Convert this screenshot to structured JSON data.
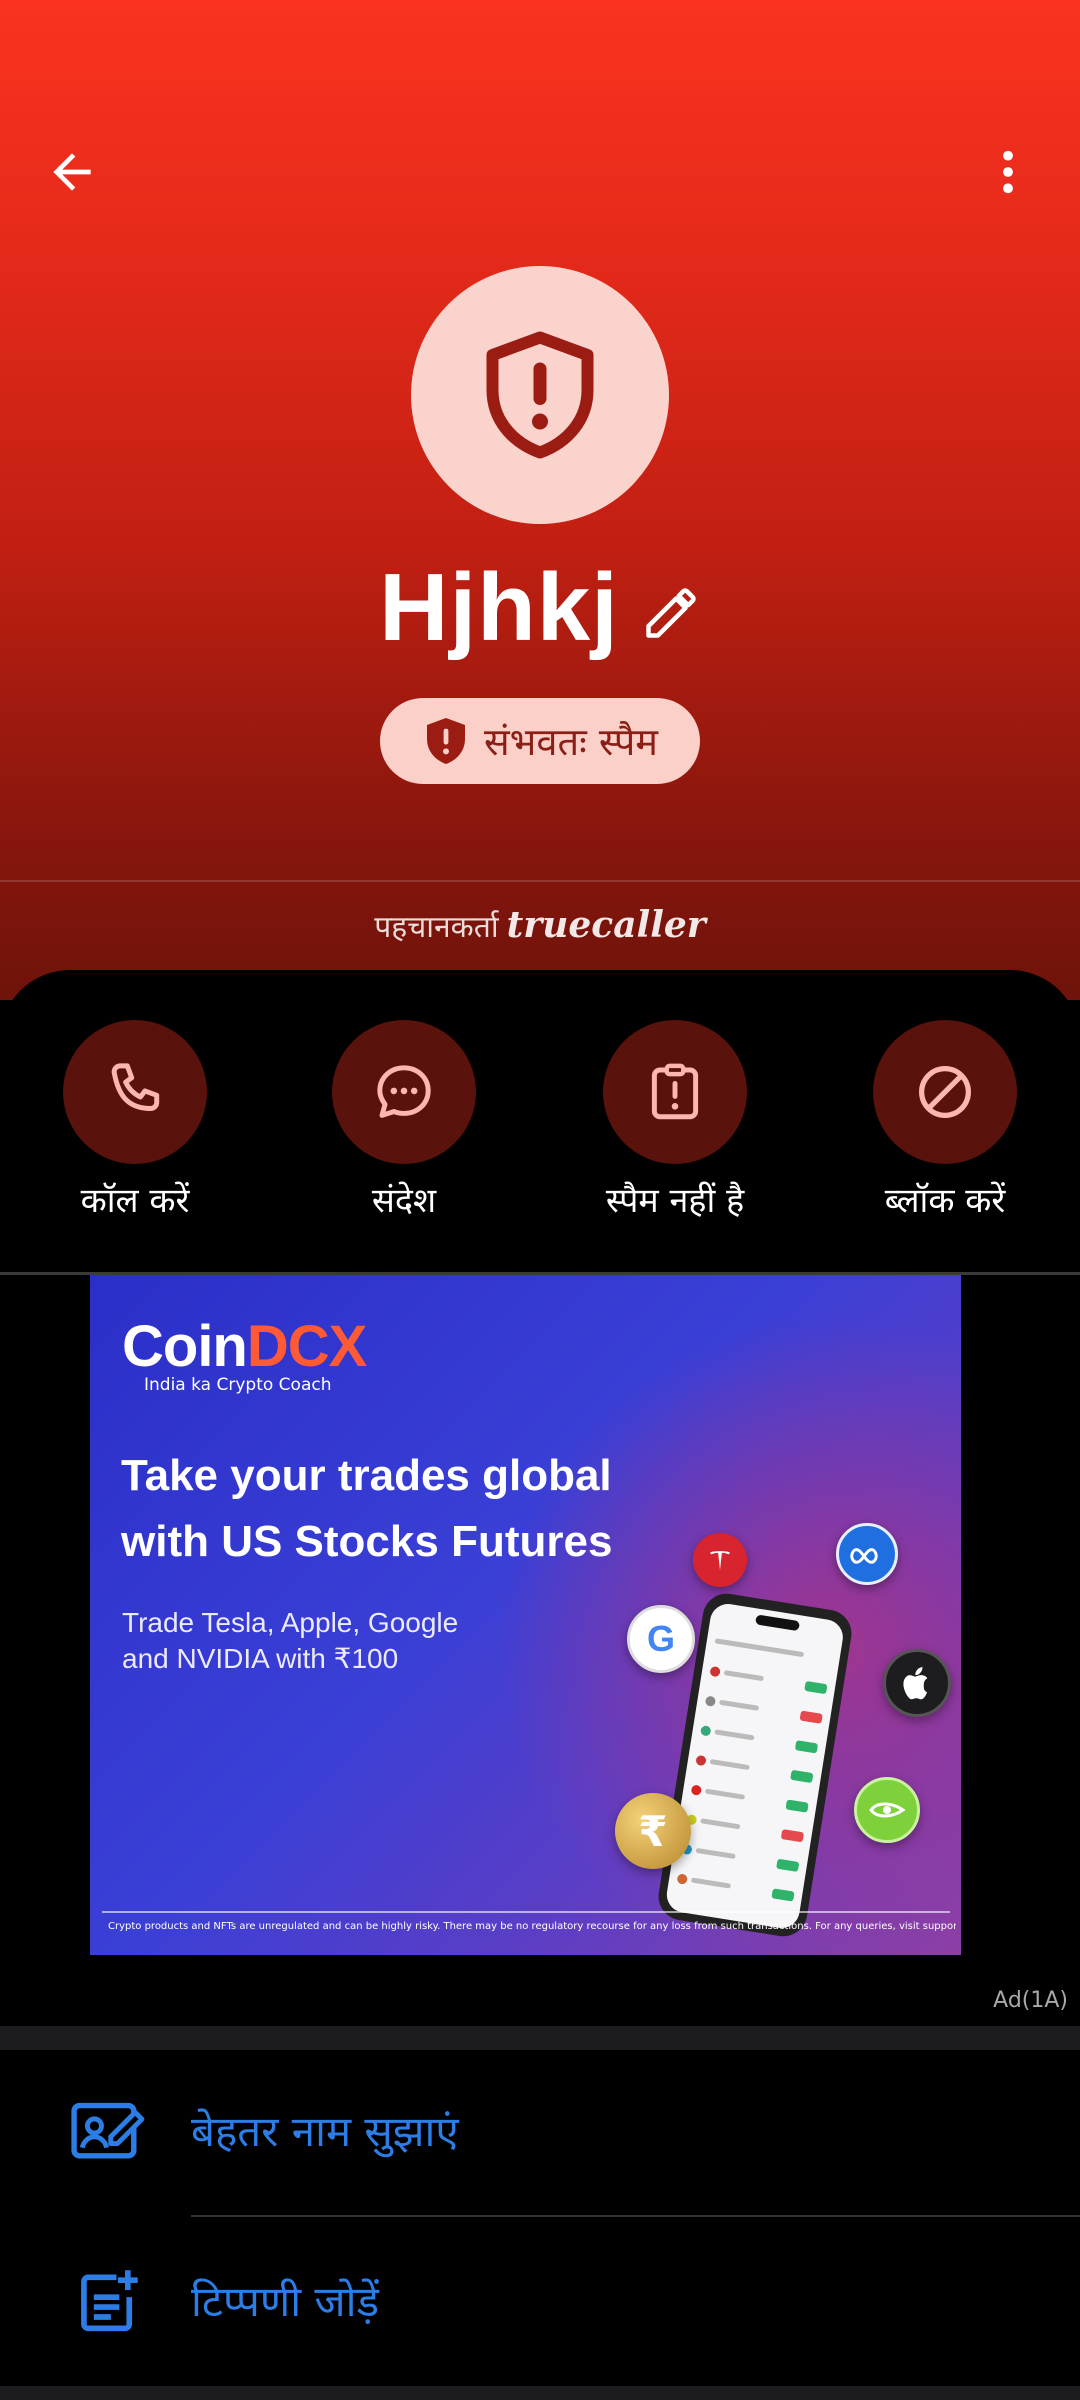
{
  "contact": {
    "name": "Hjhkj",
    "spam_label": "संभवतः स्पैम",
    "identified_prefix": "पहचानकर्ता",
    "brand": "truecaller"
  },
  "actions": [
    {
      "label": "कॉल करें",
      "icon": "phone-icon"
    },
    {
      "label": "संदेश",
      "icon": "message-icon"
    },
    {
      "label": "स्पैम नहीं है",
      "icon": "not-spam-icon"
    },
    {
      "label": "ब्लॉक करें",
      "icon": "block-icon"
    }
  ],
  "ad": {
    "logo_main": "Coin",
    "logo_accent": "DCX",
    "tagline": "India ka Crypto Coach",
    "headline_line1": "Take your trades global",
    "headline_line2": "with US Stocks Futures",
    "sub_line1": "Trade Tesla, Apple, Google",
    "sub_line2": "and NVIDIA with ₹100",
    "disclaimer": "Crypto products and NFTs are unregulated and can be highly risky. There may be no regulatory recourse for any loss from such transactions. For any queries, visit support.coindcx.com",
    "coin_rupee": "₹",
    "coin_google": "G",
    "ad_label": "Ad(1A)"
  },
  "list": [
    {
      "label": "बेहतर नाम सुझाएं",
      "icon": "suggest-name-icon"
    },
    {
      "label": "टिप्पणी जोड़ें",
      "icon": "add-note-icon"
    }
  ],
  "colors": {
    "hero_top": "#fb3220",
    "hero_bottom": "#6e130b",
    "badge_bg": "#fbd0c9",
    "action_circle": "#5a120c",
    "action_icon": "#fcb8ae",
    "link_blue": "#2c7de6"
  }
}
